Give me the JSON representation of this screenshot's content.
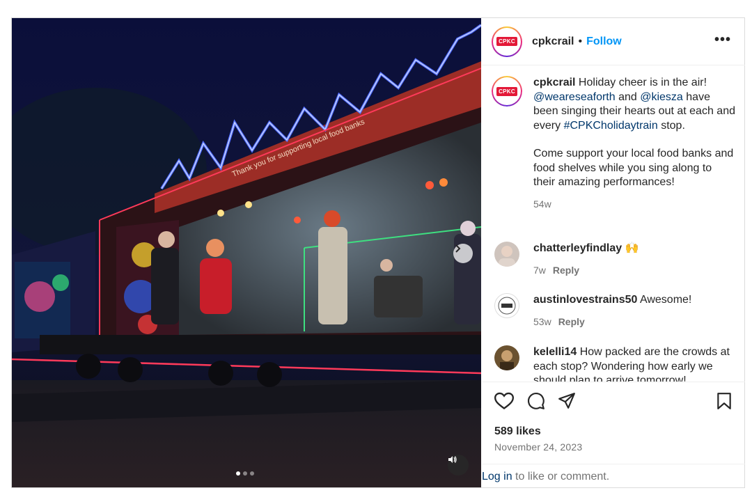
{
  "post": {
    "username": "cpkcrail",
    "follow_label": "Follow",
    "separator": "•",
    "more_label": "•••",
    "logo_text": "CPKC",
    "media_banner_text": "Thank you for supporting local food banks",
    "carousel": {
      "count": 3,
      "active_index": 0
    }
  },
  "caption": {
    "username": "cpkcrail",
    "text_1": " Holiday cheer is in the air! ",
    "mention_1": "@weareseaforth",
    "text_2": " and ",
    "mention_2": "@kiesza",
    "text_3": " have been singing their hearts out at each and every ",
    "hashtag": "#CPKCholidaytrain",
    "text_4": " stop.",
    "paragraph_2": "Come support your local food banks and food shelves while you sing along to their amazing performances!",
    "time": "54w"
  },
  "comments": [
    {
      "username": "chatterleyfindlay",
      "text": " 🙌",
      "time": "7w",
      "reply": "Reply"
    },
    {
      "username": "austinlovestrains50",
      "text": " Awesome!",
      "time": "53w",
      "reply": "Reply"
    },
    {
      "username": "kelelli14",
      "text": " How packed are the crowds at each stop? Wondering how early we should plan to arrive tomorrow!"
    }
  ],
  "stats": {
    "likes": "589 likes",
    "date": "November 24, 2023"
  },
  "footer": {
    "login_link": "Log in",
    "login_text": " to like or comment."
  },
  "colors": {
    "follow": "#0095f6",
    "link": "#00376b",
    "muted": "#737373",
    "brand": "#e31837"
  },
  "icons": [
    "heart-icon",
    "comment-icon",
    "share-icon",
    "bookmark-icon",
    "chevron-right-icon",
    "speaker-icon"
  ]
}
